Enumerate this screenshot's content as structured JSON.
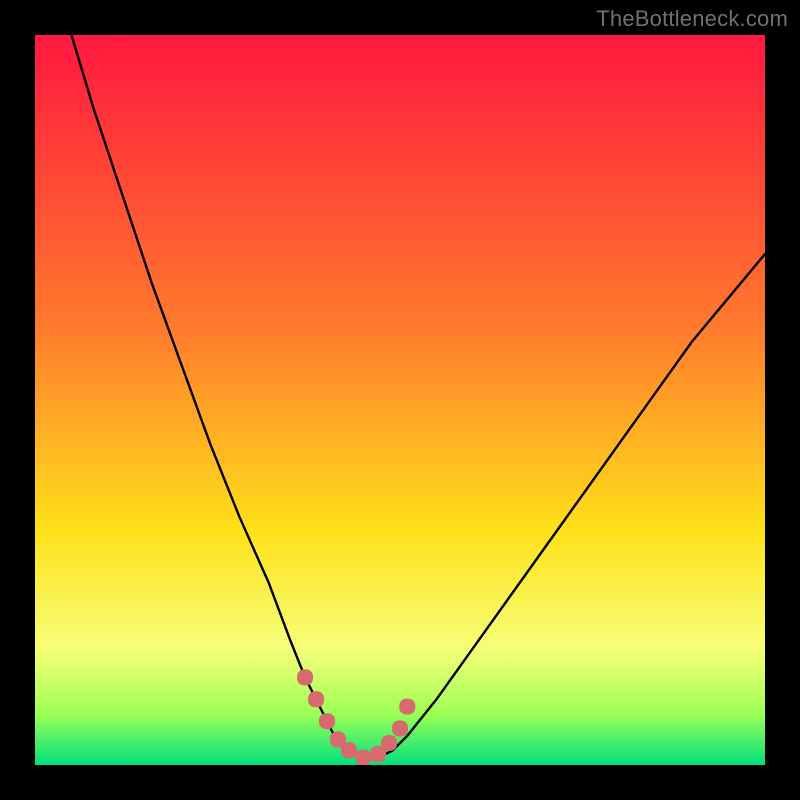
{
  "watermark": "TheBottleneck.com",
  "colors": {
    "frame": "#000000",
    "gradient_top": "#ff183f",
    "gradient_mid1": "#ff7a2d",
    "gradient_mid2": "#ffe11a",
    "gradient_band": "#f6ff78",
    "gradient_low": "#9dff55",
    "gradient_bottom": "#00e07e",
    "curve": "#000000",
    "marker": "#d66a6e"
  },
  "chart_data": {
    "type": "line",
    "title": "",
    "xlabel": "",
    "ylabel": "",
    "xlim": [
      0,
      100
    ],
    "ylim": [
      0,
      100
    ],
    "series": [
      {
        "name": "bottleneck-curve",
        "x": [
          5,
          8,
          12,
          16,
          20,
          24,
          28,
          32,
          35,
          37,
          39,
          41,
          43,
          45,
          47,
          49,
          51,
          55,
          60,
          65,
          70,
          75,
          80,
          85,
          90,
          95,
          100
        ],
        "y": [
          100,
          90,
          78,
          66,
          55,
          44,
          34,
          25,
          17,
          12,
          8,
          4,
          2,
          1,
          1,
          2,
          4,
          9,
          16,
          23,
          30,
          37,
          44,
          51,
          58,
          64,
          70
        ]
      }
    ],
    "markers": {
      "name": "highlight-segment",
      "x": [
        37,
        38.5,
        40,
        41.5,
        43,
        45,
        47,
        48.5,
        50,
        51
      ],
      "y": [
        12,
        9,
        6,
        3.5,
        2,
        1,
        1.5,
        3,
        5,
        8
      ]
    }
  }
}
